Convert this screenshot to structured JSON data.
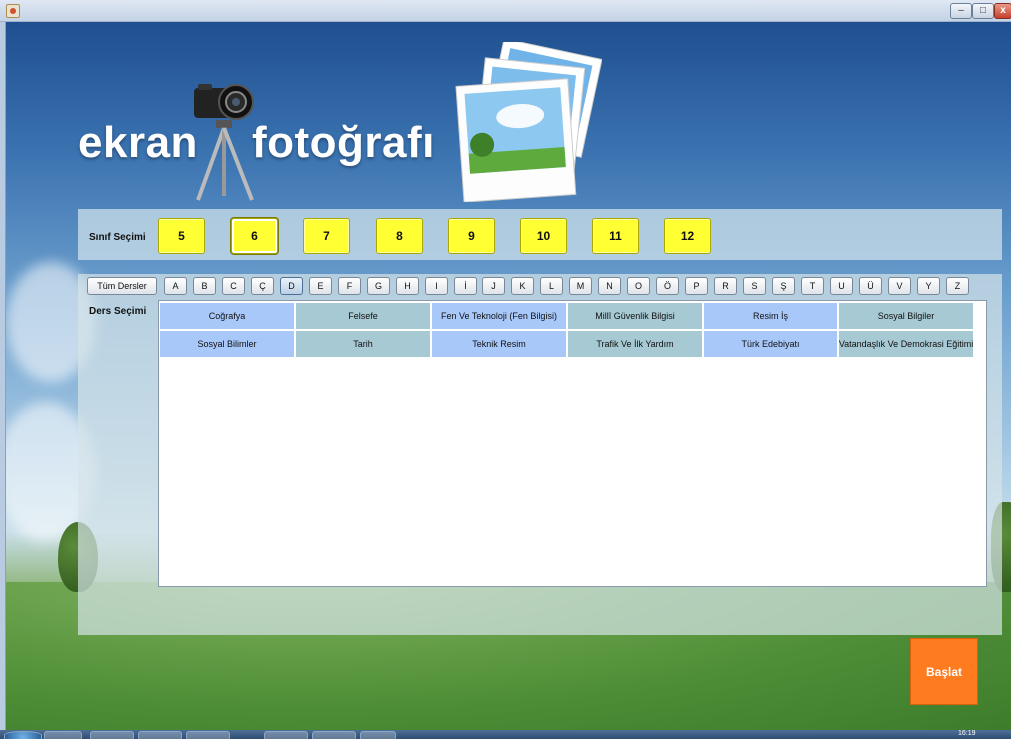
{
  "window": {
    "min_label": "–",
    "max_label": "□",
    "close_label": "x"
  },
  "logo": {
    "word1": "ekran",
    "word2": "fotoğrafı"
  },
  "sinif": {
    "label": "Sınıf Seçimi",
    "grades": [
      "5",
      "6",
      "7",
      "8",
      "9",
      "10",
      "11",
      "12"
    ],
    "selected": "6"
  },
  "ders": {
    "label": "Ders Seçimi",
    "all_label": "Tüm Dersler",
    "letters": [
      "A",
      "B",
      "C",
      "Ç",
      "D",
      "E",
      "F",
      "G",
      "H",
      "I",
      "İ",
      "J",
      "K",
      "L",
      "M",
      "N",
      "O",
      "Ö",
      "P",
      "R",
      "S",
      "Ş",
      "T",
      "U",
      "Ü",
      "V",
      "Y",
      "Z"
    ],
    "active_letter": "D",
    "courses": [
      {
        "name": "Coğrafya",
        "tone": "blue"
      },
      {
        "name": "Felsefe",
        "tone": "gray"
      },
      {
        "name": "Fen Ve Teknoloji (Fen Bilgisi)",
        "tone": "blue"
      },
      {
        "name": "Millî Güvenlik Bilgisi",
        "tone": "gray"
      },
      {
        "name": "Resim İş",
        "tone": "blue"
      },
      {
        "name": "Sosyal Bilgiler",
        "tone": "gray"
      },
      {
        "name": "Sosyal Bilimler",
        "tone": "blue"
      },
      {
        "name": "Tarih",
        "tone": "gray"
      },
      {
        "name": "Teknik Resim",
        "tone": "blue"
      },
      {
        "name": "Trafik Ve İlk Yardım",
        "tone": "gray"
      },
      {
        "name": "Türk Edebiyatı",
        "tone": "blue"
      },
      {
        "name": "Vatandaşlık Ve Demokrasi Eğitimi",
        "tone": "gray"
      }
    ]
  },
  "start_label": "Başlat",
  "taskbar": {
    "clock": "16:19"
  },
  "colors": {
    "grade_bg": "#ffff33",
    "start_bg": "#ff7b1f",
    "cell_blue": "#a9c8fa",
    "cell_gray": "#a7c9d3"
  }
}
